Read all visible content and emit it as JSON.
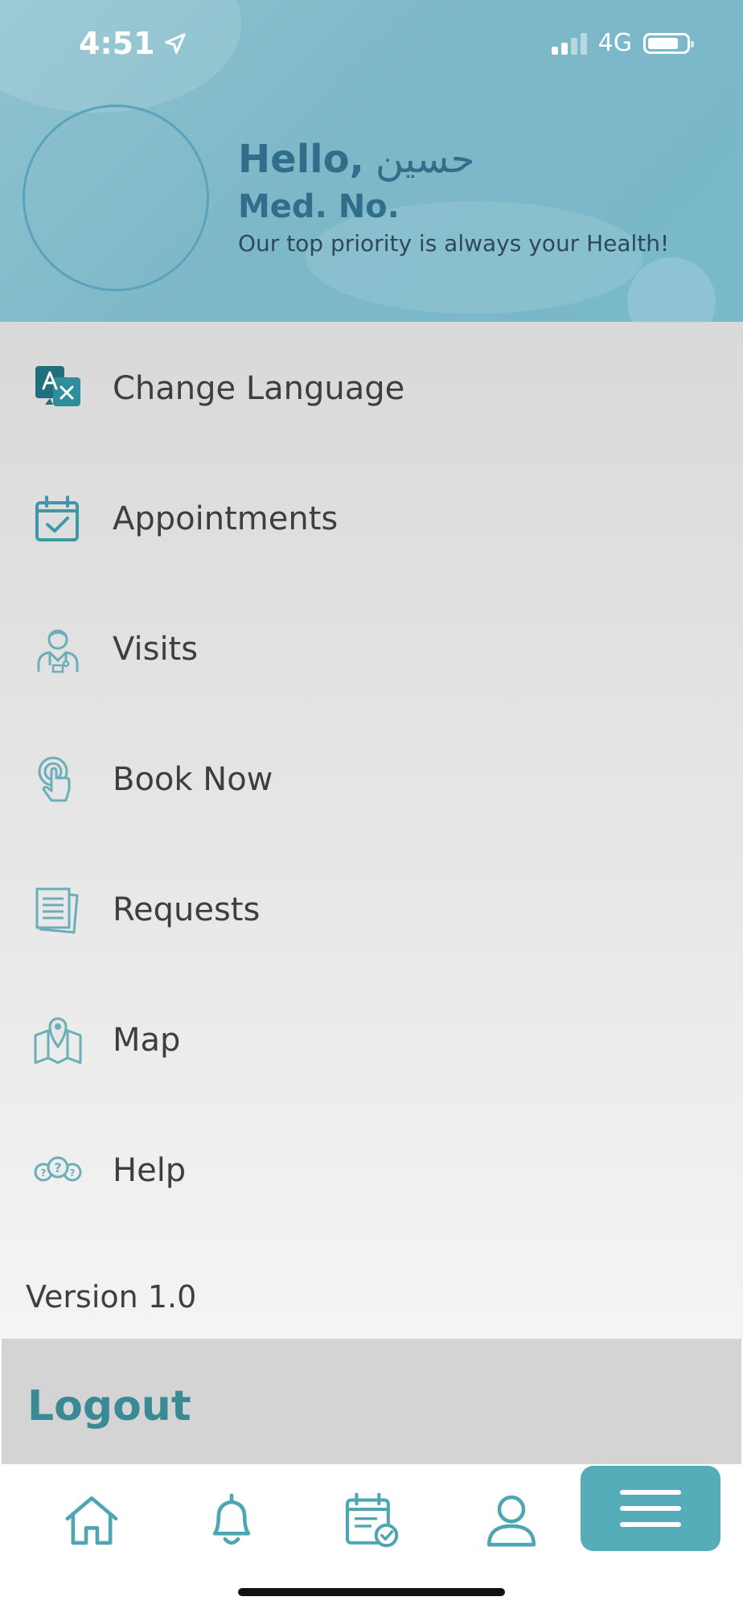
{
  "status_bar": {
    "time": "4:51",
    "network": "4G"
  },
  "profile": {
    "hello": "Hello,",
    "name": "حسين",
    "med_no_label": "Med. No.",
    "tagline": "Our top priority is always your Health!"
  },
  "menu": {
    "items": [
      {
        "label": "Change Language",
        "icon": "translate-icon"
      },
      {
        "label": "Appointments",
        "icon": "calendar-check-icon"
      },
      {
        "label": "Visits",
        "icon": "doctor-icon"
      },
      {
        "label": "Book Now",
        "icon": "tap-hand-icon"
      },
      {
        "label": "Requests",
        "icon": "documents-icon"
      },
      {
        "label": "Map",
        "icon": "map-pin-icon"
      },
      {
        "label": "Help",
        "icon": "help-bubbles-icon"
      }
    ]
  },
  "version": "Version 1.0",
  "logout_label": "Logout",
  "tabbar": {
    "tabs": [
      "home-icon",
      "bell-icon",
      "calendar-check-icon",
      "user-icon",
      "menu-icon"
    ],
    "active": "menu-icon"
  },
  "colors": {
    "accent": "#55adb9",
    "header": "#7db8c8",
    "greeting_text": "#2f6f8c",
    "logout_text": "#3a8a95",
    "icon_stroke": "#4fa6b3"
  }
}
